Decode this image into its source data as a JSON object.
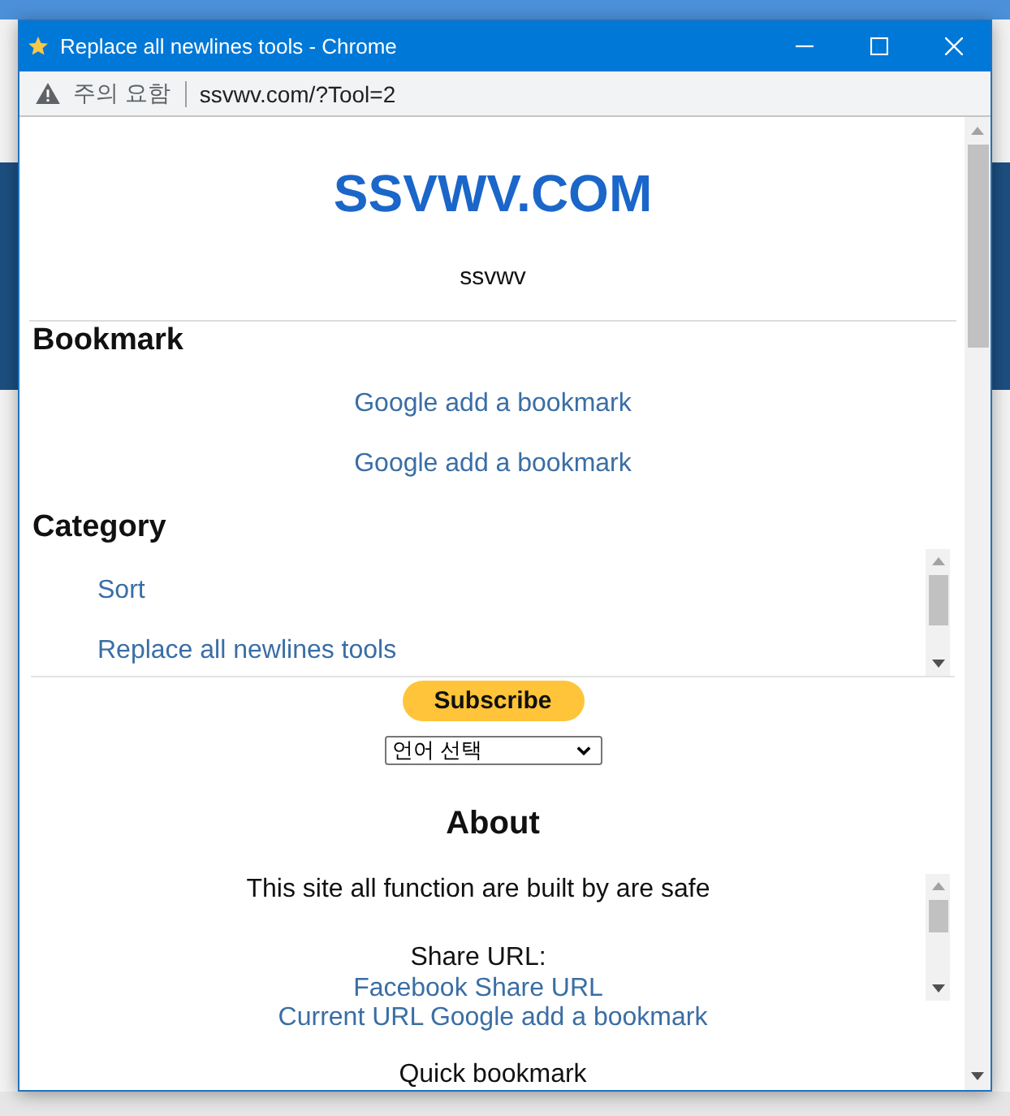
{
  "window": {
    "title": "Replace all newlines tools - Chrome"
  },
  "address_bar": {
    "security_label": "주의 요함",
    "url": "ssvwv.com/?Tool=2"
  },
  "page": {
    "site_title": "SSVWV.COM",
    "tagline": "ssvwv",
    "sections": [
      {
        "kind": "links",
        "heading": "Bookmark",
        "items": [
          "Google add a bookmark",
          "Google add a bookmark"
        ]
      },
      {
        "kind": "scroll_list",
        "heading": "Category",
        "items": [
          "Sort",
          "Replace all newlines tools"
        ]
      }
    ],
    "subscribe_button": "Subscribe",
    "language_select": {
      "value": "언어 선택"
    },
    "about": {
      "heading": "About",
      "description": "This site all function are built by are safe",
      "share_label": "Share URL:",
      "share_links": [
        "Facebook Share URL",
        "Current URL Google add a bookmark"
      ],
      "quick_bookmark": "Quick bookmark"
    }
  }
}
